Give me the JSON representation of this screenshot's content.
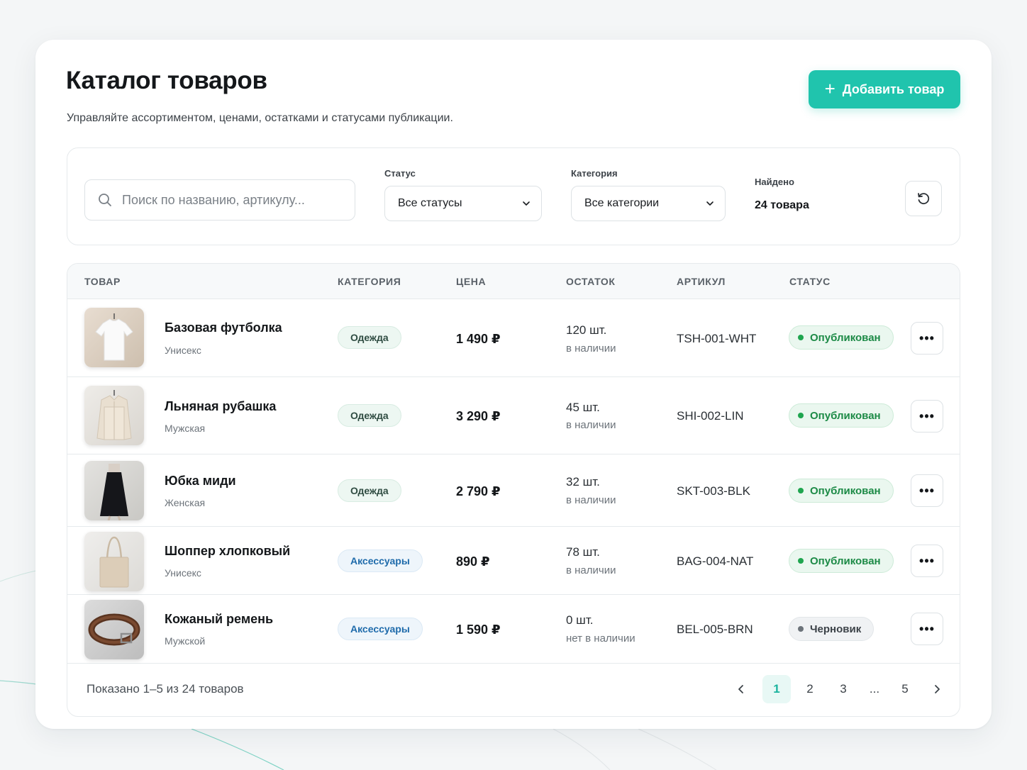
{
  "header": {
    "title": "Каталог товаров",
    "subtitle": "Управляйте ассортиментом, ценами, остатками и статусами публикации.",
    "add_button_label": "Добавить товар"
  },
  "filters": {
    "search_placeholder": "Поиск по названию, артикулу...",
    "status_label": "Статус",
    "status_value": "Все статусы",
    "category_label": "Категория",
    "category_value": "Все категории",
    "found_label": "Найдено",
    "found_value": "24 товара"
  },
  "table": {
    "columns": [
      "ТОВАР",
      "КАТЕГОРИЯ",
      "ЦЕНА",
      "ОСТАТОК",
      "АРТИКУЛ",
      "СТАТУС"
    ],
    "rows": [
      {
        "name": "Базовая футболка",
        "sub": "Унисекс",
        "category": "Одежда",
        "price": "1 490 ₽",
        "qty": "120 шт.",
        "qty_note": "в наличии",
        "sku": "TSH-001-WHT",
        "status": "Опубликован"
      },
      {
        "name": "Льняная рубашка",
        "sub": "Мужская",
        "category": "Одежда",
        "price": "3 290 ₽",
        "qty": "45 шт.",
        "qty_note": "в наличии",
        "sku": "SHI-002-LIN",
        "status": "Опубликован"
      },
      {
        "name": "Юбка миди",
        "sub": "Женская",
        "category": "Одежда",
        "price": "2 790 ₽",
        "qty": "32 шт.",
        "qty_note": "в наличии",
        "sku": "SKT-003-BLK",
        "status": "Опубликован"
      },
      {
        "name": "Шоппер хлопковый",
        "sub": "Унисекс",
        "category": "Аксессуары",
        "price": "890 ₽",
        "qty": "78 шт.",
        "qty_note": "в наличии",
        "sku": "BAG-004-NAT",
        "status": "Опубликован"
      },
      {
        "name": "Кожаный ремень",
        "sub": "Мужской",
        "category": "Аксессуары",
        "price": "1 590 ₽",
        "qty": "0 шт.",
        "qty_note": "нет в наличии",
        "sku": "BEL-005-BRN",
        "status": "Черновик"
      }
    ]
  },
  "footer": {
    "shown_text": "Показано 1–5 из 24 товаров",
    "pages": [
      "1",
      "2",
      "3",
      "...",
      "5"
    ],
    "active_page": "1"
  },
  "colors": {
    "accent": "#20c4ad",
    "published": "#1c8a46",
    "draft": "#3c4248"
  }
}
